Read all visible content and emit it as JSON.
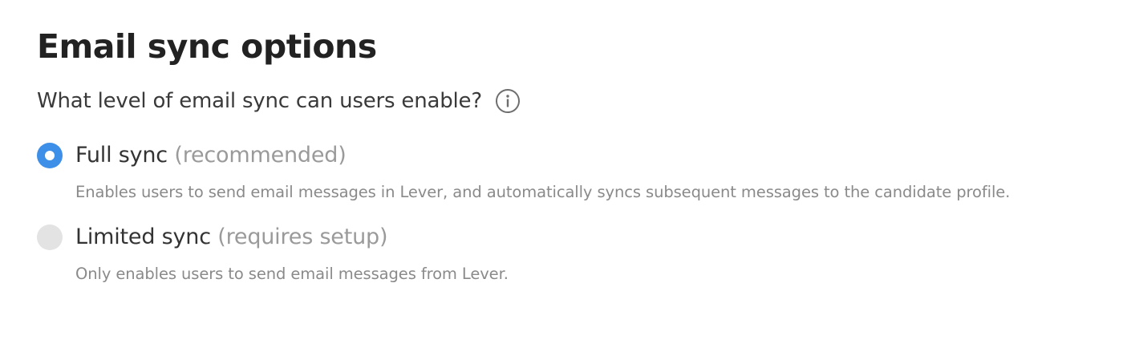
{
  "section": {
    "title": "Email sync options",
    "question": "What level of email sync can users enable?",
    "info_icon": "info-icon"
  },
  "options": [
    {
      "label": "Full sync",
      "hint": "(recommended)",
      "description": "Enables users to send email messages in Lever, and automatically syncs subsequent messages to the candidate profile.",
      "selected": true
    },
    {
      "label": "Limited sync",
      "hint": "(requires setup)",
      "description": "Only enables users to send email messages from Lever.",
      "selected": false
    }
  ],
  "colors": {
    "accent": "#3d8fe8",
    "radio_unselected": "#e3e3e3",
    "muted_text": "#9a9a9a"
  }
}
